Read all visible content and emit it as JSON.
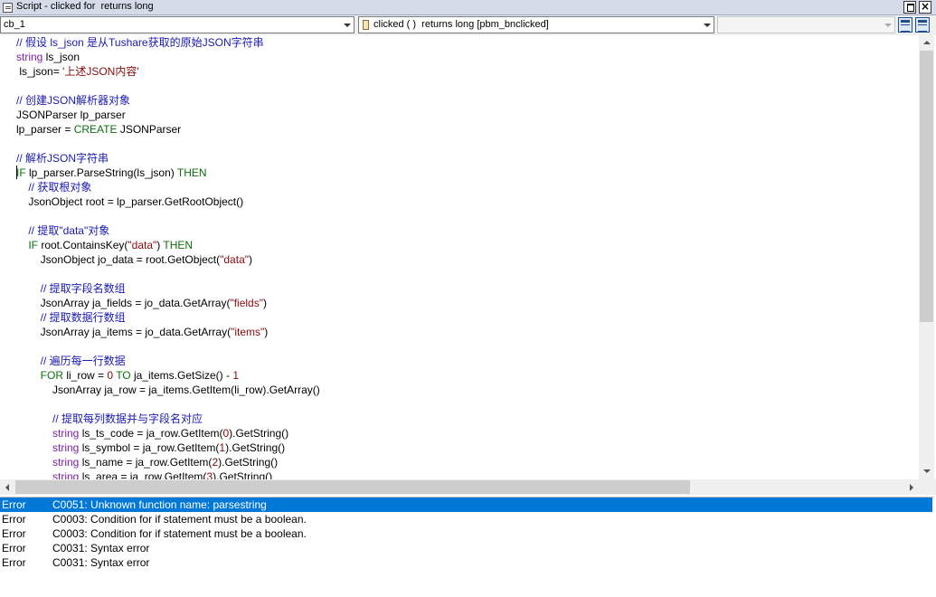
{
  "window": {
    "title": "Script - clicked for  returns long"
  },
  "toolbar": {
    "object_combo": "cb_1",
    "event_combo": "clicked ( )  returns long [pbm_bnclicked]",
    "third_combo": "",
    "view_icons": [
      "layout-split-icon",
      "layout-list-icon"
    ]
  },
  "editor": {
    "lines": [
      [
        {
          "c": "c",
          "t": "// 假设 ls_json 是从Tushare获取的原始JSON字符串"
        }
      ],
      [
        {
          "c": "t",
          "t": "string"
        },
        {
          "c": "",
          "t": " ls_json"
        }
      ],
      [
        {
          "c": "",
          "t": " ls_json= "
        },
        {
          "c": "s",
          "t": "'上述JSON内容'"
        }
      ],
      [],
      [
        {
          "c": "c",
          "t": "// 创建JSON解析器对象"
        }
      ],
      [
        {
          "c": "",
          "t": "JSONParser lp_parser"
        }
      ],
      [
        {
          "c": "",
          "t": "lp_parser = "
        },
        {
          "c": "k",
          "t": "CREATE"
        },
        {
          "c": "",
          "t": " JSONParser"
        }
      ],
      [],
      [
        {
          "c": "c",
          "t": "// 解析JSON字符串"
        }
      ],
      [
        {
          "c": "k",
          "t": "IF"
        },
        {
          "c": "",
          "t": " lp_parser.ParseString(ls_json) "
        },
        {
          "c": "k",
          "t": "THEN"
        }
      ],
      [
        {
          "c": "c",
          "t": "    // 获取根对象"
        }
      ],
      [
        {
          "c": "",
          "t": "    JsonObject root = lp_parser.GetRootObject()"
        }
      ],
      [],
      [
        {
          "c": "c",
          "t": "    // 提取\"data\"对象"
        }
      ],
      [
        {
          "c": "k",
          "t": "    IF"
        },
        {
          "c": "",
          "t": " root.ContainsKey("
        },
        {
          "c": "s",
          "t": "\"data\""
        },
        {
          "c": "",
          "t": ") "
        },
        {
          "c": "k",
          "t": "THEN"
        }
      ],
      [
        {
          "c": "",
          "t": "        JsonObject jo_data = root.GetObject("
        },
        {
          "c": "s",
          "t": "\"data\""
        },
        {
          "c": "",
          "t": ")"
        }
      ],
      [],
      [
        {
          "c": "c",
          "t": "        // 提取字段名数组"
        }
      ],
      [
        {
          "c": "",
          "t": "        JsonArray ja_fields = jo_data.GetArray("
        },
        {
          "c": "s",
          "t": "\"fields\""
        },
        {
          "c": "",
          "t": ")"
        }
      ],
      [
        {
          "c": "c",
          "t": "        // 提取数据行数组"
        }
      ],
      [
        {
          "c": "",
          "t": "        JsonArray ja_items = jo_data.GetArray("
        },
        {
          "c": "s",
          "t": "\"items\""
        },
        {
          "c": "",
          "t": ")"
        }
      ],
      [],
      [
        {
          "c": "c",
          "t": "        // 遍历每一行数据"
        }
      ],
      [
        {
          "c": "k",
          "t": "        FOR"
        },
        {
          "c": "",
          "t": " li_row = "
        },
        {
          "c": "n",
          "t": "0"
        },
        {
          "c": "",
          "t": " "
        },
        {
          "c": "k",
          "t": "TO"
        },
        {
          "c": "",
          "t": " ja_items.GetSize() - "
        },
        {
          "c": "n",
          "t": "1"
        }
      ],
      [
        {
          "c": "",
          "t": "            JsonArray ja_row = ja_items.GetItem(li_row).GetArray()"
        }
      ],
      [],
      [
        {
          "c": "c",
          "t": "            // 提取每列数据并与字段名对应"
        }
      ],
      [
        {
          "c": "t",
          "t": "            string"
        },
        {
          "c": "",
          "t": " ls_ts_code = ja_row.GetItem("
        },
        {
          "c": "n",
          "t": "0"
        },
        {
          "c": "",
          "t": ").GetString()"
        }
      ],
      [
        {
          "c": "t",
          "t": "            string"
        },
        {
          "c": "",
          "t": " ls_symbol = ja_row.GetItem("
        },
        {
          "c": "n",
          "t": "1"
        },
        {
          "c": "",
          "t": ").GetString()"
        }
      ],
      [
        {
          "c": "t",
          "t": "            string"
        },
        {
          "c": "",
          "t": " ls_name = ja_row.GetItem("
        },
        {
          "c": "n",
          "t": "2"
        },
        {
          "c": "",
          "t": ").GetString()"
        }
      ],
      [
        {
          "c": "t",
          "t": "            string"
        },
        {
          "c": "",
          "t": " ls_area = ja_row.GetItem("
        },
        {
          "c": "n",
          "t": "3"
        },
        {
          "c": "",
          "t": ").GetString()"
        }
      ]
    ]
  },
  "errors": [
    {
      "level": "Error",
      "message": "C0051: Unknown function name: parsestring"
    },
    {
      "level": "Error",
      "message": "C0003: Condition for if statement must be a boolean."
    },
    {
      "level": "Error",
      "message": "C0003: Condition for if statement must be a boolean."
    },
    {
      "level": "Error",
      "message": "C0031: Syntax error"
    },
    {
      "level": "Error",
      "message": "C0031: Syntax error"
    }
  ],
  "colors": {
    "comment": "#1a1ab0",
    "keyword": "#0d6e0d",
    "type": "#7a1fa0",
    "string": "#8a0a0a",
    "selection": "#0078d7"
  }
}
